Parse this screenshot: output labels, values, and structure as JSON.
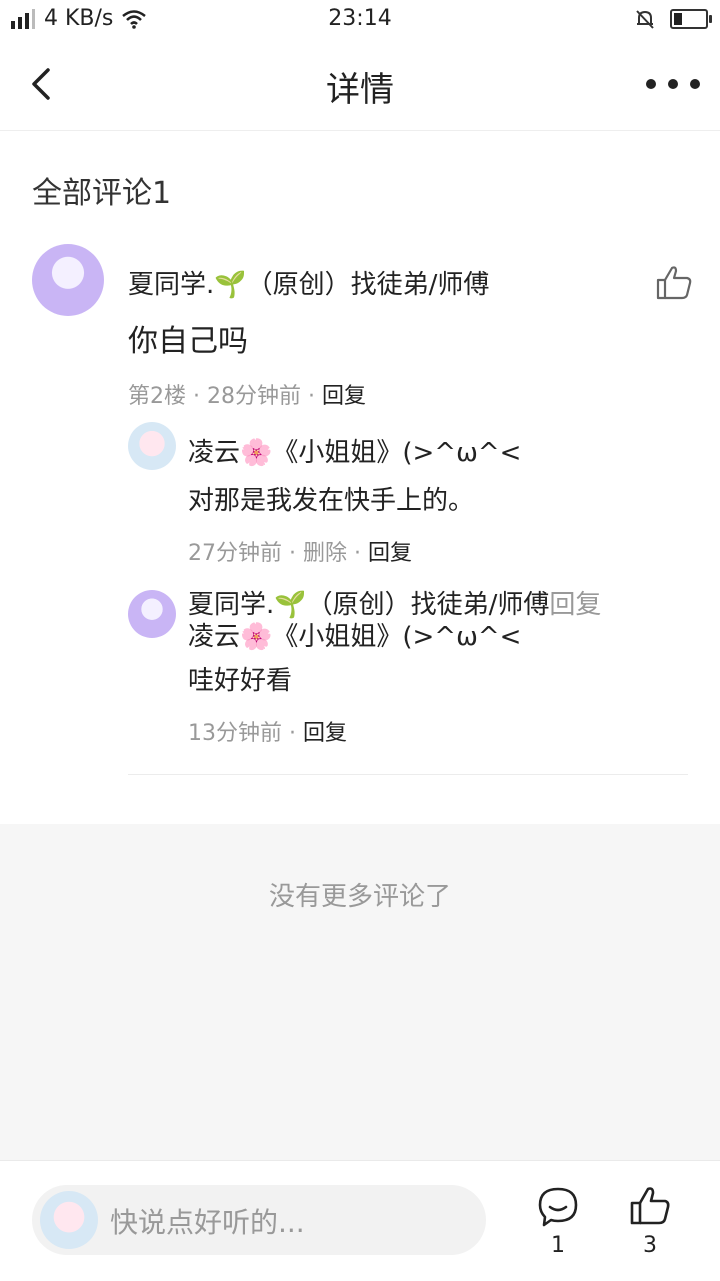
{
  "status_bar": {
    "net_speed": "4 KB/s",
    "time": "23:14"
  },
  "header": {
    "title": "详情"
  },
  "comments_section": {
    "title": "全部评论1"
  },
  "comment": {
    "author": "夏同学.🌱（原创）找徒弟/师傅",
    "text": "你自己吗",
    "floor": "第2楼",
    "time": "28分钟前",
    "reply_label": "回复",
    "replies": [
      {
        "author": "凌云🌸《小姐姐》(>^ω^<",
        "text": "对那是我发在快手上的。",
        "time": "27分钟前",
        "delete_label": "删除",
        "reply_label": "回复"
      },
      {
        "author": "夏同学.🌱（原创）找徒弟/师傅",
        "reply_word": "回复",
        "reply_to": "凌云🌸《小姐姐》(>^ω^<",
        "text": "哇好好看",
        "time": "13分钟前",
        "reply_label": "回复"
      }
    ]
  },
  "no_more_text": "没有更多评论了",
  "bottom_bar": {
    "input_placeholder": "快说点好听的...",
    "comment_count": "1",
    "like_count": "3"
  },
  "icons": {
    "back": "chevron-left-icon",
    "more": "more-dots-icon",
    "like": "thumbs-up-icon",
    "comment": "chat-bubble-icon"
  }
}
